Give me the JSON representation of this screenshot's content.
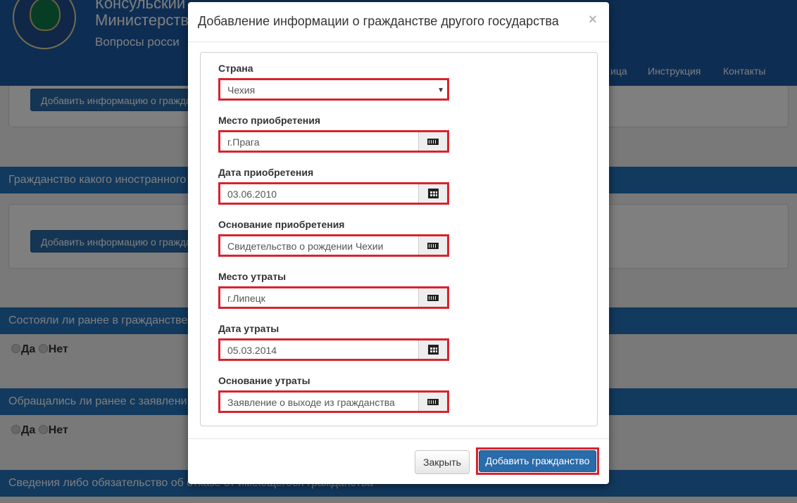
{
  "header": {
    "line1": "Консульский ",
    "line2": "Министерств",
    "line3": "Вопросы росси",
    "nav": [
      "ица",
      "Инструкция",
      "Контакты"
    ]
  },
  "background": {
    "add_button_1": "Добавить информацию о гражда",
    "section_1": "Гражданство какого иностранного",
    "add_button_2": "Добавить информацию о гражда",
    "section_2": "Состояли ли ранее в гражданстве",
    "yes": "Да",
    "no": "Нет",
    "section_3": "Обращались ли ранее с заявлени",
    "section_4": "Сведения либо обязательство об отказе от имеющегося гражданства"
  },
  "modal": {
    "title": "Добавление информации о гражданстве другого государства",
    "close_symbol": "×",
    "fields": [
      {
        "label": "Страна",
        "value": "Чехия",
        "kind": "select"
      },
      {
        "label": "Место приобретения",
        "value": "г.Прага",
        "kind": "keyboard"
      },
      {
        "label": "Дата приобретения",
        "value": "03.06.2010",
        "kind": "calendar"
      },
      {
        "label": "Основание приобретения",
        "value": "Свидетельство о рождении Чехии",
        "kind": "keyboard"
      },
      {
        "label": "Место утраты",
        "value": "г.Липецк",
        "kind": "keyboard"
      },
      {
        "label": "Дата утраты",
        "value": "05.03.2014",
        "kind": "calendar"
      },
      {
        "label": "Основание утраты",
        "value": "Заявление о выходе из гражданства",
        "kind": "keyboard"
      }
    ],
    "close_button": "Закрыть",
    "submit_button": "Добавить гражданство"
  },
  "colors": {
    "primary": "#2a6ba9",
    "header": "#1d5aa6",
    "section": "#2573bd",
    "highlight": "#d9232d"
  }
}
